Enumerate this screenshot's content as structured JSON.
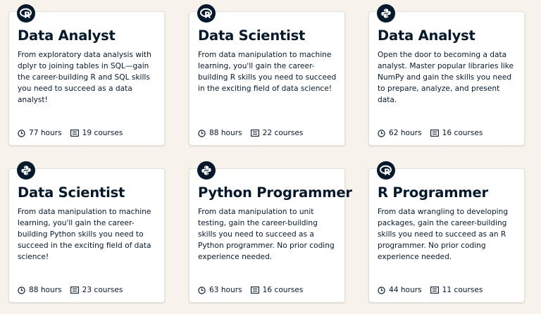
{
  "cards": [
    {
      "icon": "r-logo-icon",
      "title": "Data Analyst",
      "description": "From exploratory data analysis with dplyr to joining tables in SQL—gain the career-building R and SQL skills you need to succeed as a data analyst!",
      "hours": "77 hours",
      "courses": "19 courses"
    },
    {
      "icon": "r-logo-icon",
      "title": "Data Scientist",
      "description": "From data manipulation to machine learning, you'll gain the career-building R skills you need to succeed in the exciting field of data science!",
      "hours": "88 hours",
      "courses": "22 courses"
    },
    {
      "icon": "python-logo-icon",
      "title": "Data Analyst",
      "description": "Open the door to becoming a data analyst. Master popular libraries like NumPy and gain the skills you need to prepare, analyze, and present data.",
      "hours": "62 hours",
      "courses": "16 courses"
    },
    {
      "icon": "python-logo-icon",
      "title": "Data Scientist",
      "description": "From data manipulation to machine learning, you'll gain the career-building Python skills you need to succeed in the exciting field of data science!",
      "hours": "88 hours",
      "courses": "23 courses"
    },
    {
      "icon": "python-logo-icon",
      "title": "Python Programmer",
      "description": "From data manipulation to unit testing, gain the career-building skills you need to succeed as a Python programmer. No prior coding experience needed.",
      "hours": "63 hours",
      "courses": "16 courses"
    },
    {
      "icon": "r-logo-icon",
      "title": "R Programmer",
      "description": "From data wrangling to developing packages, gain the career-building skills you need to succeed as an R programmer. No prior coding experience needed.",
      "hours": "44 hours",
      "courses": "11 courses"
    }
  ],
  "colors": {
    "background": "#f7f3eb",
    "card": "#ffffff",
    "text": "#05192d",
    "badge": "#05192d"
  }
}
